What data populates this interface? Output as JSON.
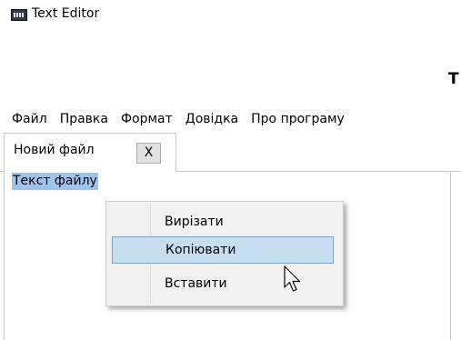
{
  "window": {
    "title": "Text Editor",
    "icon": "text-editor-app-icon"
  },
  "page_heading": "T",
  "menubar": {
    "items": [
      "Файл",
      "Правка",
      "Формат",
      "Довідка",
      "Про програму"
    ]
  },
  "tabs": [
    {
      "label": "Новий файл",
      "close_label": "X"
    }
  ],
  "editor": {
    "content": "Текст файлу",
    "selected": true
  },
  "context_menu": {
    "items": [
      {
        "label": "Вирізати",
        "highlighted": false
      },
      {
        "label": "Копіювати",
        "highlighted": true
      },
      {
        "label": "Вставити",
        "highlighted": false
      }
    ]
  },
  "colors": {
    "selection": "#9dc4ea",
    "menu_highlight": "#c5dff0",
    "menu_highlight_border": "#6ea8d7"
  },
  "cursor": "arrow-cursor-icon"
}
